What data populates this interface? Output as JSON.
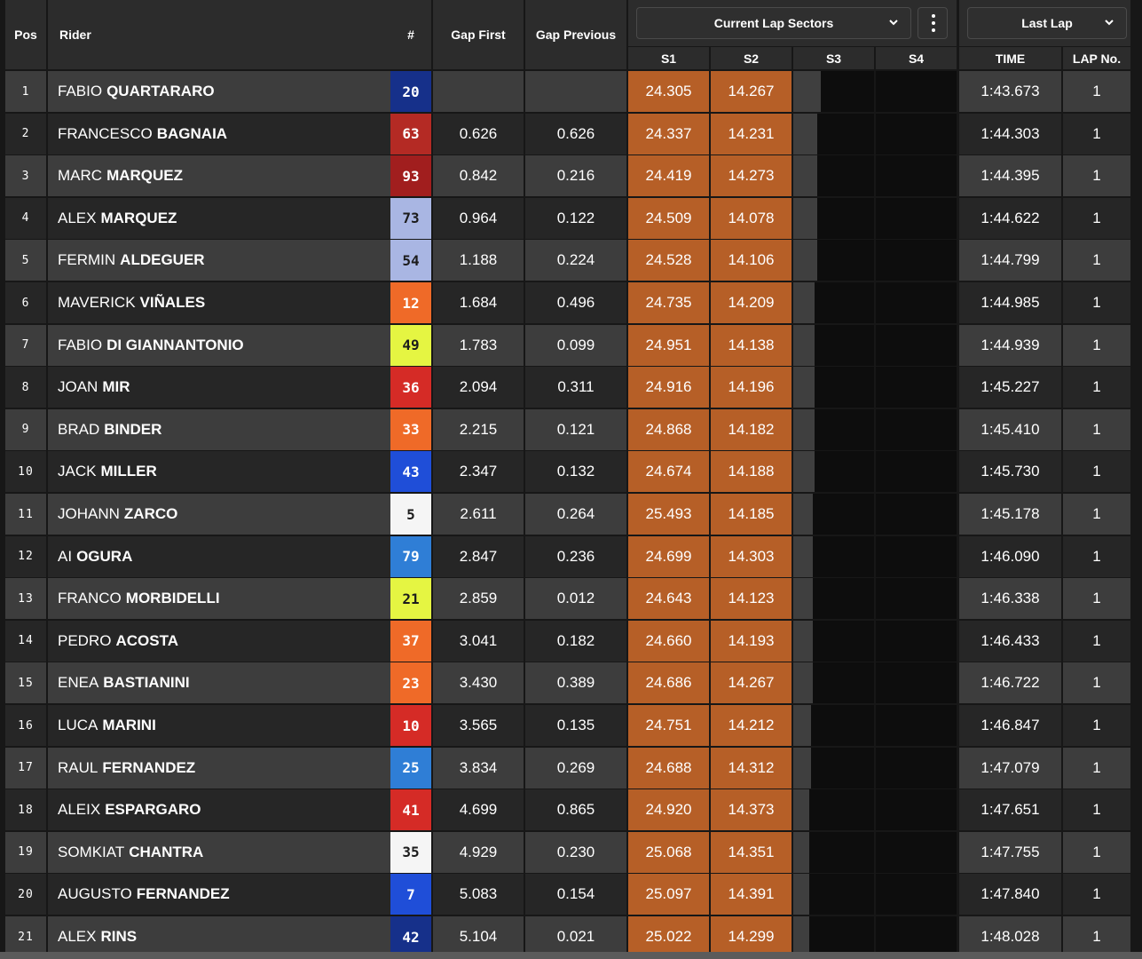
{
  "header": {
    "pos": "Pos",
    "rider": "Rider",
    "number": "#",
    "gap_first": "Gap First",
    "gap_previous": "Gap Previous",
    "sectors_dropdown": "Current Lap Sectors",
    "last_lap_dropdown": "Last Lap",
    "s1": "S1",
    "s2": "S2",
    "s3": "S3",
    "s4": "S4",
    "time": "TIME",
    "lap_no": "LAP No."
  },
  "colors": {
    "sector_fill": "#b65f27",
    "row_light": "#3d3d3d",
    "row_dark": "#262626"
  },
  "riders": [
    {
      "pos": "1",
      "first": "FABIO",
      "last": "QUARTARARO",
      "num": "20",
      "num_bg": "#16308a",
      "num_fg": "#ffffff",
      "gap_first": "",
      "gap_prev": "",
      "s1": "24.305",
      "s2": "14.267",
      "time": "1:43.673",
      "lap": "1",
      "s3_progress": 0.34
    },
    {
      "pos": "2",
      "first": "FRANCESCO",
      "last": "BAGNAIA",
      "num": "63",
      "num_bg": "#b42a24",
      "num_fg": "#ffffff",
      "gap_first": "0.626",
      "gap_prev": "0.626",
      "s1": "24.337",
      "s2": "14.231",
      "time": "1:44.303",
      "lap": "1",
      "s3_progress": 0.3
    },
    {
      "pos": "3",
      "first": "MARC",
      "last": "MARQUEZ",
      "num": "93",
      "num_bg": "#a11e1e",
      "num_fg": "#ffffff",
      "gap_first": "0.842",
      "gap_prev": "0.216",
      "s1": "24.419",
      "s2": "14.273",
      "time": "1:44.395",
      "lap": "1",
      "s3_progress": 0.3
    },
    {
      "pos": "4",
      "first": "ALEX",
      "last": "MARQUEZ",
      "num": "73",
      "num_bg": "#a9b6e3",
      "num_fg": "#1c1c1c",
      "gap_first": "0.964",
      "gap_prev": "0.122",
      "s1": "24.509",
      "s2": "14.078",
      "time": "1:44.622",
      "lap": "1",
      "s3_progress": 0.3
    },
    {
      "pos": "5",
      "first": "FERMIN",
      "last": "ALDEGUER",
      "num": "54",
      "num_bg": "#a9b6e3",
      "num_fg": "#1c1c1c",
      "gap_first": "1.188",
      "gap_prev": "0.224",
      "s1": "24.528",
      "s2": "14.106",
      "time": "1:44.799",
      "lap": "1",
      "s3_progress": 0.3
    },
    {
      "pos": "6",
      "first": "MAVERICK",
      "last": "VIÑALES",
      "num": "12",
      "num_bg": "#ef6a28",
      "num_fg": "#ffffff",
      "gap_first": "1.684",
      "gap_prev": "0.496",
      "s1": "24.735",
      "s2": "14.209",
      "time": "1:44.985",
      "lap": "1",
      "s3_progress": 0.26
    },
    {
      "pos": "7",
      "first": "FABIO",
      "last": "DI GIANNANTONIO",
      "num": "49",
      "num_bg": "#e5f542",
      "num_fg": "#1c1c1c",
      "gap_first": "1.783",
      "gap_prev": "0.099",
      "s1": "24.951",
      "s2": "14.138",
      "time": "1:44.939",
      "lap": "1",
      "s3_progress": 0.26
    },
    {
      "pos": "8",
      "first": "JOAN",
      "last": "MIR",
      "num": "36",
      "num_bg": "#d52b26",
      "num_fg": "#ffffff",
      "gap_first": "2.094",
      "gap_prev": "0.311",
      "s1": "24.916",
      "s2": "14.196",
      "time": "1:45.227",
      "lap": "1",
      "s3_progress": 0.26
    },
    {
      "pos": "9",
      "first": "BRAD",
      "last": "BINDER",
      "num": "33",
      "num_bg": "#ef6a28",
      "num_fg": "#ffffff",
      "gap_first": "2.215",
      "gap_prev": "0.121",
      "s1": "24.868",
      "s2": "14.182",
      "time": "1:45.410",
      "lap": "1",
      "s3_progress": 0.26
    },
    {
      "pos": "10",
      "first": "JACK",
      "last": "MILLER",
      "num": "43",
      "num_bg": "#1f4ed8",
      "num_fg": "#ffffff",
      "gap_first": "2.347",
      "gap_prev": "0.132",
      "s1": "24.674",
      "s2": "14.188",
      "time": "1:45.730",
      "lap": "1",
      "s3_progress": 0.26
    },
    {
      "pos": "11",
      "first": "JOHANN",
      "last": "ZARCO",
      "num": "5",
      "num_bg": "#f5f5f5",
      "num_fg": "#1c1c1c",
      "gap_first": "2.611",
      "gap_prev": "0.264",
      "s1": "25.493",
      "s2": "14.185",
      "time": "1:45.178",
      "lap": "1",
      "s3_progress": 0.24
    },
    {
      "pos": "12",
      "first": "AI",
      "last": "OGURA",
      "num": "79",
      "num_bg": "#2f7ed6",
      "num_fg": "#ffffff",
      "gap_first": "2.847",
      "gap_prev": "0.236",
      "s1": "24.699",
      "s2": "14.303",
      "time": "1:46.090",
      "lap": "1",
      "s3_progress": 0.24
    },
    {
      "pos": "13",
      "first": "FRANCO",
      "last": "MORBIDELLI",
      "num": "21",
      "num_bg": "#e5f542",
      "num_fg": "#1c1c1c",
      "gap_first": "2.859",
      "gap_prev": "0.012",
      "s1": "24.643",
      "s2": "14.123",
      "time": "1:46.338",
      "lap": "1",
      "s3_progress": 0.24
    },
    {
      "pos": "14",
      "first": "PEDRO",
      "last": "ACOSTA",
      "num": "37",
      "num_bg": "#ef6a28",
      "num_fg": "#ffffff",
      "gap_first": "3.041",
      "gap_prev": "0.182",
      "s1": "24.660",
      "s2": "14.193",
      "time": "1:46.433",
      "lap": "1",
      "s3_progress": 0.24
    },
    {
      "pos": "15",
      "first": "ENEA",
      "last": "BASTIANINI",
      "num": "23",
      "num_bg": "#ef6a28",
      "num_fg": "#ffffff",
      "gap_first": "3.430",
      "gap_prev": "0.389",
      "s1": "24.686",
      "s2": "14.267",
      "time": "1:46.722",
      "lap": "1",
      "s3_progress": 0.24
    },
    {
      "pos": "16",
      "first": "LUCA",
      "last": "MARINI",
      "num": "10",
      "num_bg": "#d52b26",
      "num_fg": "#ffffff",
      "gap_first": "3.565",
      "gap_prev": "0.135",
      "s1": "24.751",
      "s2": "14.212",
      "time": "1:46.847",
      "lap": "1",
      "s3_progress": 0.22
    },
    {
      "pos": "17",
      "first": "RAUL",
      "last": "FERNANDEZ",
      "num": "25",
      "num_bg": "#2f7ed6",
      "num_fg": "#ffffff",
      "gap_first": "3.834",
      "gap_prev": "0.269",
      "s1": "24.688",
      "s2": "14.312",
      "time": "1:47.079",
      "lap": "1",
      "s3_progress": 0.22
    },
    {
      "pos": "18",
      "first": "ALEIX",
      "last": "ESPARGARO",
      "num": "41",
      "num_bg": "#d52b26",
      "num_fg": "#ffffff",
      "gap_first": "4.699",
      "gap_prev": "0.865",
      "s1": "24.920",
      "s2": "14.373",
      "time": "1:47.651",
      "lap": "1",
      "s3_progress": 0.2
    },
    {
      "pos": "19",
      "first": "SOMKIAT",
      "last": "CHANTRA",
      "num": "35",
      "num_bg": "#f5f5f5",
      "num_fg": "#1c1c1c",
      "gap_first": "4.929",
      "gap_prev": "0.230",
      "s1": "25.068",
      "s2": "14.351",
      "time": "1:47.755",
      "lap": "1",
      "s3_progress": 0.2
    },
    {
      "pos": "20",
      "first": "AUGUSTO",
      "last": "FERNANDEZ",
      "num": "7",
      "num_bg": "#1f4ed8",
      "num_fg": "#ffffff",
      "gap_first": "5.083",
      "gap_prev": "0.154",
      "s1": "25.097",
      "s2": "14.391",
      "time": "1:47.840",
      "lap": "1",
      "s3_progress": 0.2
    },
    {
      "pos": "21",
      "first": "ALEX",
      "last": "RINS",
      "num": "42",
      "num_bg": "#16308a",
      "num_fg": "#ffffff",
      "gap_first": "5.104",
      "gap_prev": "0.021",
      "s1": "25.022",
      "s2": "14.299",
      "time": "1:48.028",
      "lap": "1",
      "s3_progress": 0.2
    }
  ]
}
